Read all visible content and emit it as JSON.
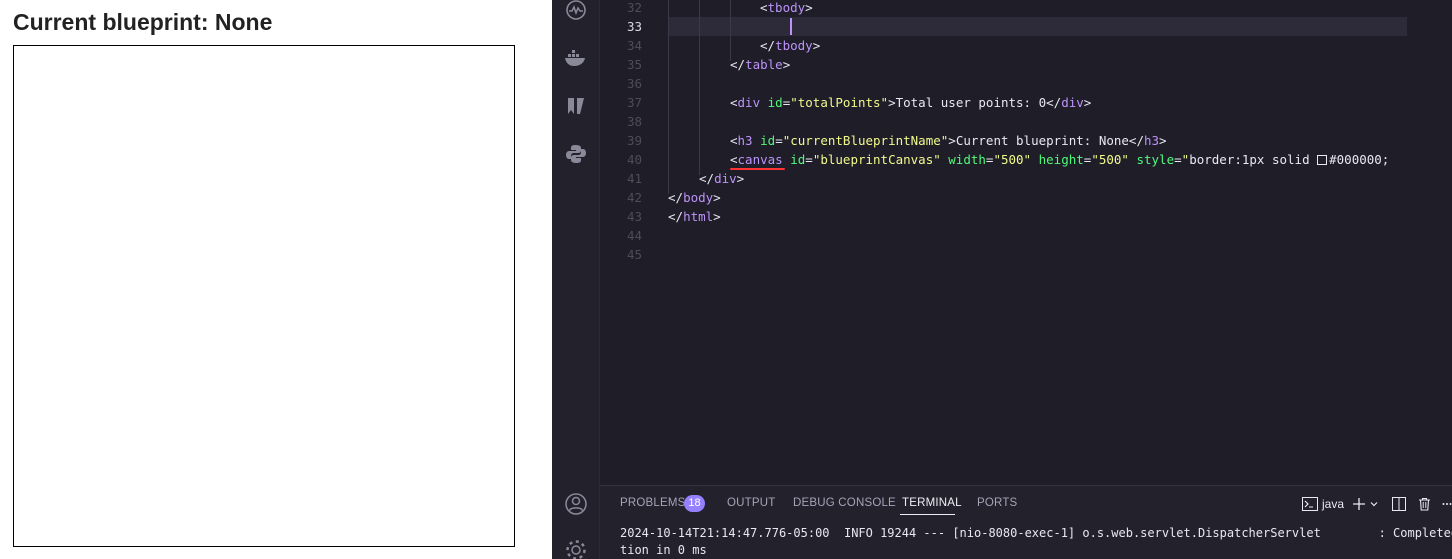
{
  "browser": {
    "heading": "Current blueprint: None"
  },
  "editor": {
    "activity_icons": [
      "pulse-icon",
      "docker-icon",
      "bookmark-icon",
      "python-icon",
      "account-icon",
      "settings-icon"
    ],
    "lines": [
      {
        "n": "32",
        "text_parts": [
          [
            "br",
            "<"
          ],
          [
            "tag",
            "tbody"
          ],
          [
            "br",
            ">"
          ]
        ],
        "indent": 92
      },
      {
        "n": "33",
        "text_parts": [],
        "indent": 0,
        "active": true
      },
      {
        "n": "34",
        "text_parts": [
          [
            "br",
            "</"
          ],
          [
            "tag",
            "tbody"
          ],
          [
            "br",
            ">"
          ]
        ],
        "indent": 92
      },
      {
        "n": "35",
        "text_parts": [
          [
            "br",
            "</"
          ],
          [
            "tag",
            "table"
          ],
          [
            "br",
            ">"
          ]
        ],
        "indent": 62
      },
      {
        "n": "36",
        "text_parts": [],
        "indent": 0
      },
      {
        "n": "37",
        "text_parts": [
          [
            "br",
            "<"
          ],
          [
            "tag",
            "div"
          ],
          [
            "txt",
            " "
          ],
          [
            "attr",
            "id"
          ],
          [
            "br",
            "="
          ],
          [
            "str",
            "\"totalPoints\""
          ],
          [
            "br",
            ">"
          ],
          [
            "txt",
            "Total user points: 0"
          ],
          [
            "br",
            "</"
          ],
          [
            "tag",
            "div"
          ],
          [
            "br",
            ">"
          ]
        ],
        "indent": 62
      },
      {
        "n": "38",
        "text_parts": [],
        "indent": 0
      },
      {
        "n": "39",
        "text_parts": [
          [
            "br",
            "<"
          ],
          [
            "tag",
            "h3"
          ],
          [
            "txt",
            " "
          ],
          [
            "attr",
            "id"
          ],
          [
            "br",
            "="
          ],
          [
            "str",
            "\"currentBlueprintName\""
          ],
          [
            "br",
            ">"
          ],
          [
            "txt",
            "Current blueprint: None"
          ],
          [
            "br",
            "</"
          ],
          [
            "tag",
            "h3"
          ],
          [
            "br",
            ">"
          ]
        ],
        "indent": 62
      },
      {
        "n": "40",
        "text_parts": [
          [
            "br",
            "<"
          ],
          [
            "tag",
            "canvas"
          ],
          [
            "txt",
            " "
          ],
          [
            "attr",
            "id"
          ],
          [
            "br",
            "="
          ],
          [
            "str",
            "\"blueprintCanvas\""
          ],
          [
            "txt",
            " "
          ],
          [
            "attr",
            "width"
          ],
          [
            "br",
            "="
          ],
          [
            "str",
            "\"500\""
          ],
          [
            "txt",
            " "
          ],
          [
            "attr",
            "height"
          ],
          [
            "br",
            "="
          ],
          [
            "str",
            "\"500\""
          ],
          [
            "txt",
            " "
          ],
          [
            "attr",
            "style"
          ],
          [
            "br",
            "="
          ],
          [
            "str",
            "\""
          ],
          [
            "txt",
            "border:1px solid "
          ],
          [
            "box",
            ""
          ],
          [
            "txt",
            "#000000;"
          ]
        ],
        "indent": 62
      },
      {
        "n": "41",
        "text_parts": [
          [
            "br",
            "</"
          ],
          [
            "tag",
            "div"
          ],
          [
            "br",
            ">"
          ]
        ],
        "indent": 31
      },
      {
        "n": "42",
        "text_parts": [
          [
            "br",
            "</"
          ],
          [
            "tag",
            "body"
          ],
          [
            "br",
            ">"
          ]
        ],
        "indent": 0
      },
      {
        "n": "43",
        "text_parts": [
          [
            "br",
            "</"
          ],
          [
            "tag",
            "html"
          ],
          [
            "br",
            ">"
          ]
        ],
        "indent": 0
      },
      {
        "n": "44",
        "text_parts": [],
        "indent": 0
      },
      {
        "n": "45",
        "text_parts": [],
        "indent": 0
      }
    ]
  },
  "panel": {
    "tabs": {
      "problems": "PROBLEMS",
      "problems_count": "18",
      "output": "OUTPUT",
      "debug_console": "DEBUG CONSOLE",
      "terminal": "TERMINAL",
      "ports": "PORTS"
    },
    "terminal_name": "java",
    "terminal_lines": [
      "2024-10-14T21:14:47.776-05:00  INFO 19244 --- [nio-8080-exec-1] o.s.web.servlet.DispatcherServlet        : Completed in",
      "tion in 0 ms"
    ]
  }
}
